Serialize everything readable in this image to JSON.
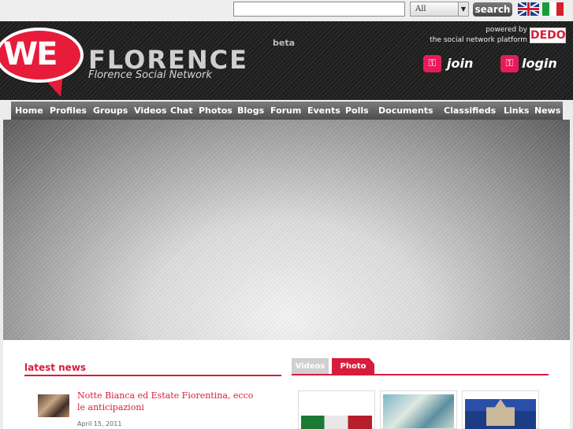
{
  "search": {
    "placeholder": "",
    "scope_selected": "All",
    "button_label": "search"
  },
  "languages": [
    {
      "name": "English"
    },
    {
      "name": "Italiano"
    }
  ],
  "brand": {
    "logo_text": "WE",
    "name": "FLORENCE",
    "badge": "beta",
    "tagline": "Florence Social Network"
  },
  "powered": {
    "line1": "powered by",
    "line2": "the social network platform",
    "logo": "DEDO"
  },
  "account": {
    "join_label": "join",
    "login_label": "login"
  },
  "nav": [
    "Home",
    "Profiles",
    "Groups",
    "Videos",
    "Chat",
    "Photos",
    "Blogs",
    "Forum",
    "Events",
    "Polls",
    "Documents",
    "Classifieds",
    "Links",
    "News"
  ],
  "news": {
    "section_title": "latest news",
    "items": [
      {
        "headline": "Notte Bianca ed Estate Fiorentina, ecco le anticipazioni",
        "date": "April 15, 2011"
      }
    ]
  },
  "media": {
    "tabs": [
      "Videos",
      "Photo"
    ],
    "active_tab": "Photo"
  },
  "colors": {
    "accent": "#d81c3c",
    "logo_red": "#e61c3a",
    "nav_dark": "#4d4d4d"
  }
}
